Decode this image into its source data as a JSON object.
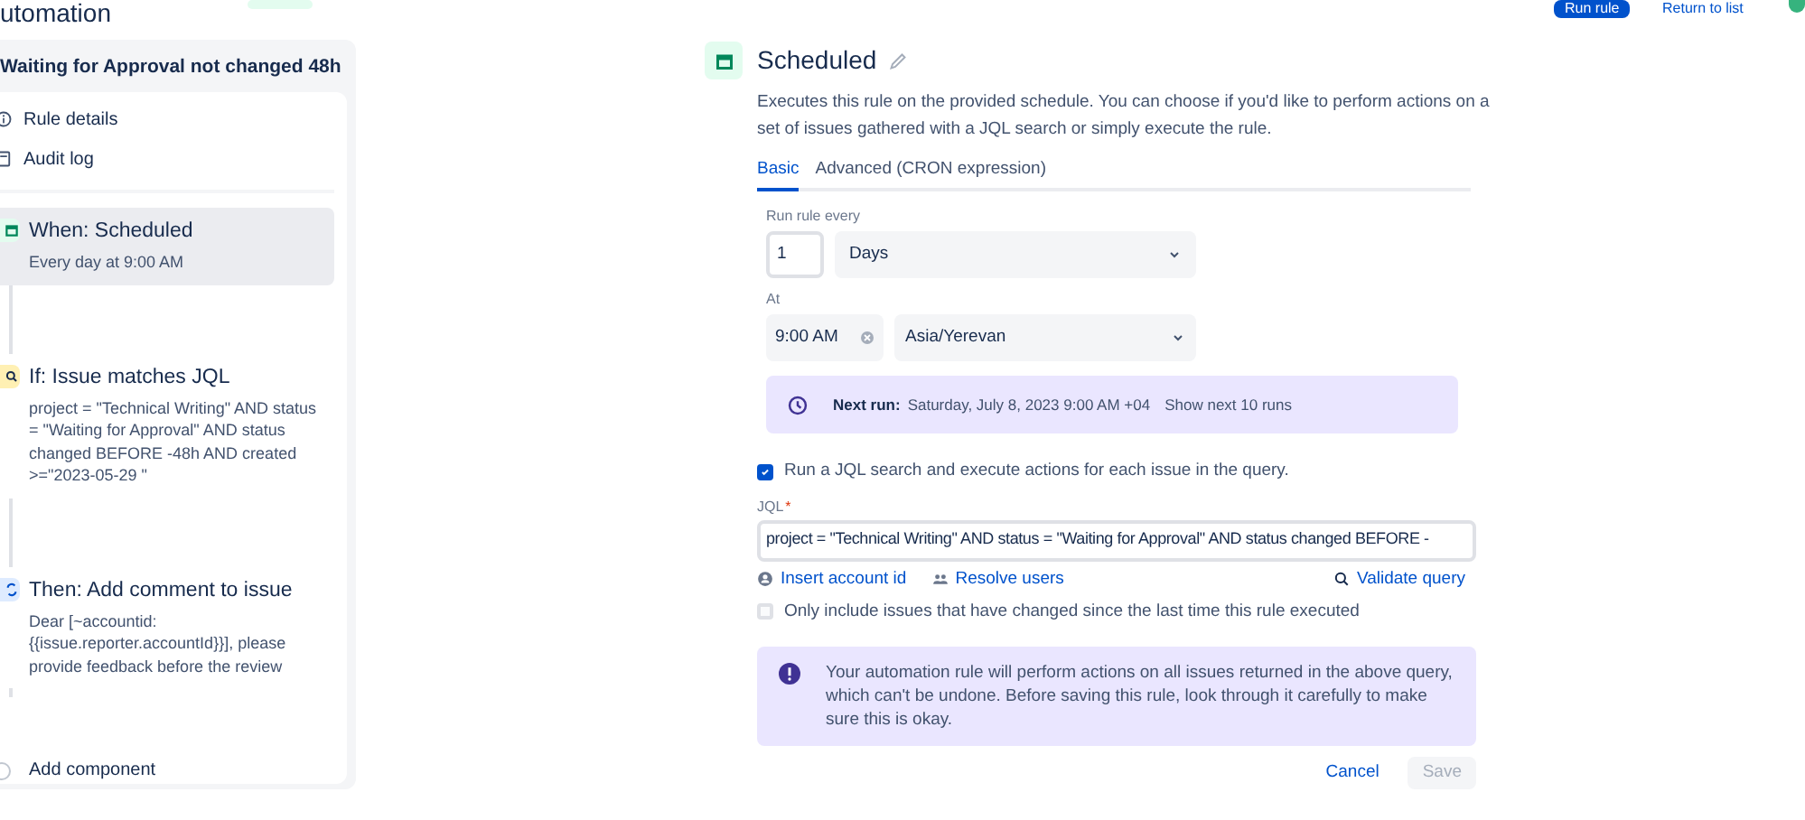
{
  "header": {
    "title": "utomation",
    "run_button": "Run rule",
    "return_link": "Return to list"
  },
  "sidebar": {
    "rule_name": "Waiting for Approval not changed 48h",
    "links": [
      {
        "kind": "info",
        "label": "Rule details"
      },
      {
        "kind": "log",
        "label": "Audit log"
      }
    ],
    "components": [
      {
        "kind": "trigger",
        "title": "When: Scheduled",
        "detail": "Every day at 9:00 AM",
        "selected": true
      },
      {
        "kind": "condition",
        "title": "If: Issue matches JQL",
        "detail": "project = \"Technical Writing\" AND status = \"Waiting for Approval\" AND status changed BEFORE -48h AND created >=\"2023-05-29 \"",
        "selected": false
      },
      {
        "kind": "action",
        "title": "Then: Add comment to issue",
        "detail": "Dear [~accountid: {{issue.reporter.accountId}}], please provide feedback before the review",
        "selected": false
      }
    ],
    "add_component": "Add component"
  },
  "panel": {
    "title": "Scheduled",
    "description": "Executes this rule on the provided schedule. You can choose if you'd like to perform actions on a set of issues gathered with a JQL search or simply execute the rule.",
    "tabs": [
      {
        "label": "Basic",
        "selected": true
      },
      {
        "label": "Advanced (CRON expression)",
        "selected": false
      }
    ],
    "run_every_label": "Run rule every",
    "interval": "1",
    "unit": "Days",
    "at_label": "At",
    "time": "9:00 AM",
    "timezone": "Asia/Yerevan",
    "next_run": {
      "label": "Next run:",
      "value": "Saturday, July 8, 2023 9:00 AM +04",
      "link": "Show next 10 runs"
    },
    "jql_search": {
      "label": "Run a JQL search and execute actions for each issue in the query.",
      "checked": true
    },
    "jql_label": "JQL",
    "jql_required": "*",
    "jql": "project = \"Technical Writing\" AND status = \"Waiting for Approval\" AND status changed BEFORE -",
    "jql_links": [
      {
        "kind": "account",
        "label": "Insert account id"
      },
      {
        "kind": "users",
        "label": "Resolve users"
      },
      {
        "kind": "validate",
        "label": "Validate query"
      }
    ],
    "only_changed": {
      "label": "Only include issues that have changed since the last time this rule executed",
      "checked": false
    },
    "warning": "Your automation rule will perform actions on all issues returned in the above query, which can't be undone. Before saving this rule, look through it carefully to make sure this is okay.",
    "buttons": [
      {
        "label": "Cancel",
        "disabled": false
      },
      {
        "label": "Save",
        "disabled": true
      }
    ]
  }
}
